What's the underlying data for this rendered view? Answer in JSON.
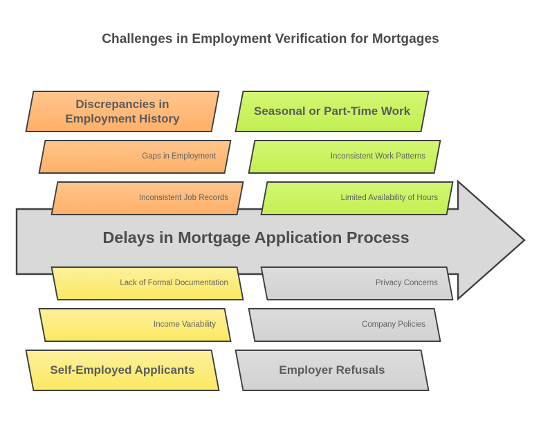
{
  "title": "Challenges in Employment Verification for Mortgages",
  "center": {
    "label": "Delays in Mortgage Application Process"
  },
  "colors": {
    "orange": "#FFC080",
    "green": "#CCF566",
    "yellow": "#FCEE7E",
    "gray": "#D6D6D6",
    "border": "#404040",
    "text": "#5B5B5B",
    "title_text": "#4A4A4A",
    "background": "#FFFFFF"
  },
  "categories": [
    {
      "id": "discrepancies",
      "position": "top-left",
      "color": "orange",
      "header": "Discrepancies in Employment History",
      "causes": [
        "Gaps in Employment",
        "Inconsistent Job Records"
      ]
    },
    {
      "id": "seasonal",
      "position": "top-right",
      "color": "green",
      "header": "Seasonal or Part-Time Work",
      "causes": [
        "Inconsistent Work Patterns",
        "Limited Availability of Hours"
      ]
    },
    {
      "id": "self-employed",
      "position": "bottom-left",
      "color": "yellow",
      "header": "Self-Employed Applicants",
      "causes": [
        "Lack of Formal Documentation",
        "Income Variability"
      ]
    },
    {
      "id": "employer-refusals",
      "position": "bottom-right",
      "color": "gray",
      "header": "Employer Refusals",
      "causes": [
        "Privacy Concerns",
        "Company Policies"
      ]
    }
  ]
}
